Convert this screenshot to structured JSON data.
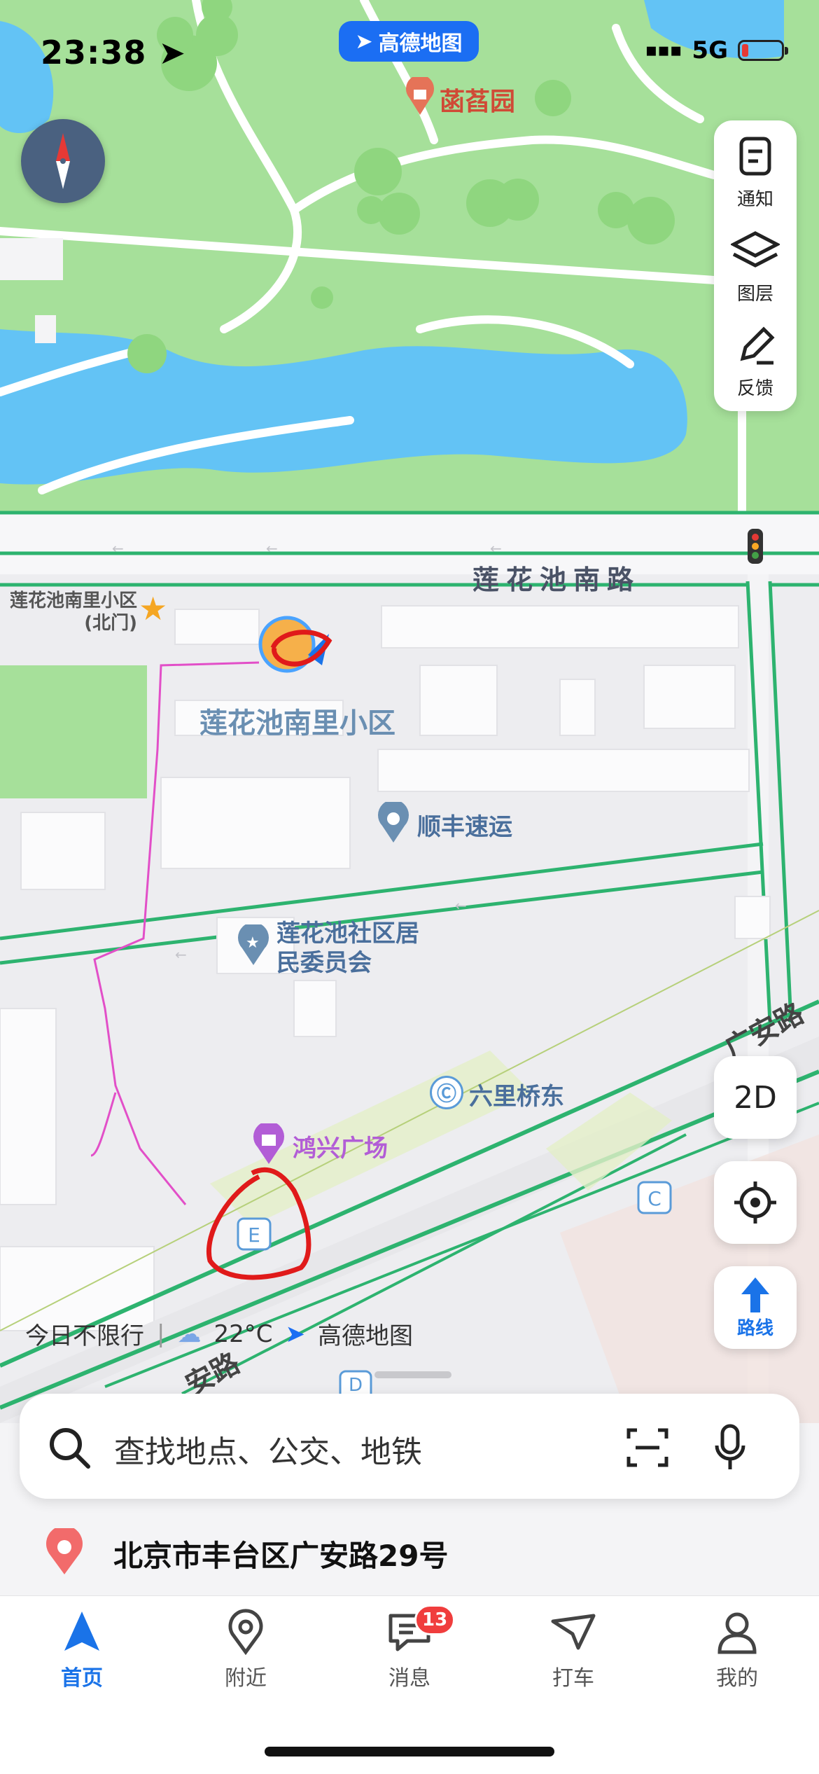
{
  "status_bar": {
    "time": "23:38",
    "app_name": "高德地图",
    "network": "5G"
  },
  "map": {
    "pois": {
      "park": "菡萏园",
      "north_gate": "莲花池南里小区(北门)",
      "residential": "莲花池南里小区",
      "shunfeng": "顺丰速运",
      "committee": "莲花池社区居民委员会",
      "liuliqiao": "六里桥东",
      "hongxing": "鸿兴广场"
    },
    "roads": {
      "lianhuachi_south": "莲花池南路",
      "guang_an_right": "广安路",
      "guang_an_bottom": "安路"
    },
    "exits": {
      "e": "E",
      "c": "C",
      "d": "D"
    }
  },
  "controls": {
    "notify": "通知",
    "layers": "图层",
    "feedback": "反馈",
    "view_mode": "2D",
    "route": "路线"
  },
  "info_bar": {
    "restriction": "今日不限行",
    "temperature": "22°C",
    "watermark": "高德地图"
  },
  "search": {
    "placeholder": "查找地点、公交、地铁"
  },
  "location": {
    "address": "北京市丰台区广安路29号"
  },
  "tabs": [
    {
      "label": "首页",
      "active": true
    },
    {
      "label": "附近",
      "active": false
    },
    {
      "label": "消息",
      "active": false,
      "badge": "13"
    },
    {
      "label": "打车",
      "active": false
    },
    {
      "label": "我的",
      "active": false
    }
  ],
  "colors": {
    "accent": "#1a73e8",
    "park_green": "#a6e09a",
    "water": "#63c3f5",
    "road_green": "#2db36f",
    "track": "#e24fc8",
    "annotation_red": "#e01a1a"
  }
}
